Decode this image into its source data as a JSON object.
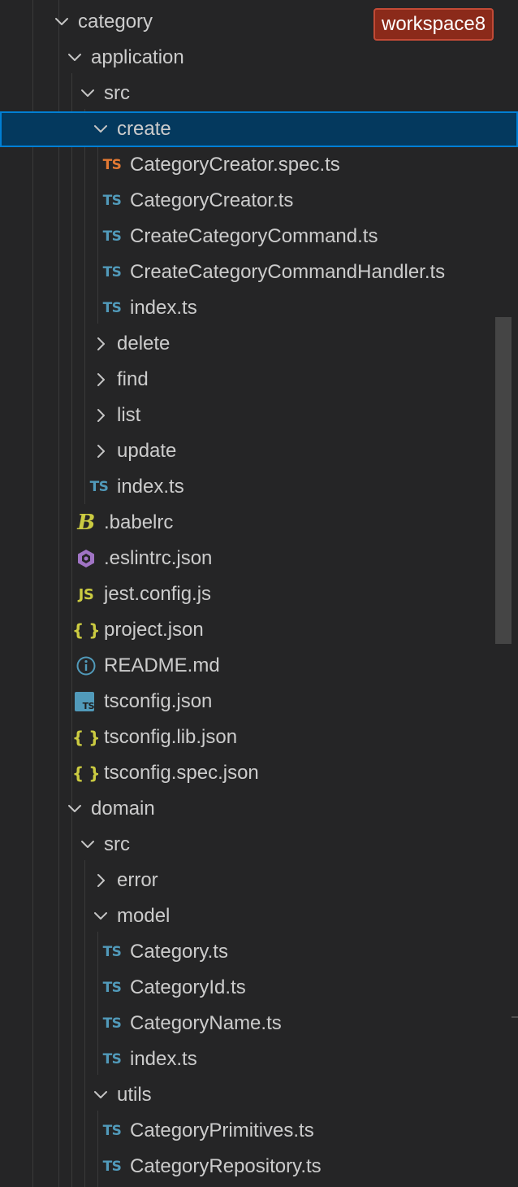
{
  "workspace_badge": "workspace8",
  "colors": {
    "ts_blue": "#519aba",
    "ts_spec_orange": "#e37933",
    "babel_yellow": "#cbcb41",
    "eslint_purple": "#a074c4",
    "json_yellow": "#cbcb41",
    "info_blue": "#519aba",
    "selection_bg": "#04395e",
    "selection_border": "#007fd4"
  },
  "tree": [
    {
      "label": "category",
      "depth": 0,
      "kind": "folder",
      "expanded": true
    },
    {
      "label": "application",
      "depth": 1,
      "kind": "folder",
      "expanded": true
    },
    {
      "label": "src",
      "depth": 2,
      "kind": "folder",
      "expanded": true
    },
    {
      "label": "create",
      "depth": 3,
      "kind": "folder",
      "expanded": true,
      "selected": true
    },
    {
      "label": "CategoryCreator.spec.ts",
      "depth": 4,
      "kind": "file",
      "icon": "ts-spec-icon",
      "glyph": "TS"
    },
    {
      "label": "CategoryCreator.ts",
      "depth": 4,
      "kind": "file",
      "icon": "typescript-icon",
      "glyph": "TS"
    },
    {
      "label": "CreateCategoryCommand.ts",
      "depth": 4,
      "kind": "file",
      "icon": "typescript-icon",
      "glyph": "TS"
    },
    {
      "label": "CreateCategoryCommandHandler.ts",
      "depth": 4,
      "kind": "file",
      "icon": "typescript-icon",
      "glyph": "TS"
    },
    {
      "label": "index.ts",
      "depth": 4,
      "kind": "file",
      "icon": "typescript-icon",
      "glyph": "TS"
    },
    {
      "label": "delete",
      "depth": 3,
      "kind": "folder",
      "expanded": false
    },
    {
      "label": "find",
      "depth": 3,
      "kind": "folder",
      "expanded": false
    },
    {
      "label": "list",
      "depth": 3,
      "kind": "folder",
      "expanded": false
    },
    {
      "label": "update",
      "depth": 3,
      "kind": "folder",
      "expanded": false
    },
    {
      "label": "index.ts",
      "depth": 3,
      "kind": "file",
      "icon": "typescript-icon",
      "glyph": "TS"
    },
    {
      "label": ".babelrc",
      "depth": 2,
      "kind": "file",
      "icon": "babel-icon",
      "glyph": "B"
    },
    {
      "label": ".eslintrc.json",
      "depth": 2,
      "kind": "file",
      "icon": "eslint-icon",
      "glyph": ""
    },
    {
      "label": "jest.config.js",
      "depth": 2,
      "kind": "file",
      "icon": "javascript-icon",
      "glyph": "JS"
    },
    {
      "label": "project.json",
      "depth": 2,
      "kind": "file",
      "icon": "json-icon",
      "glyph": "{ }"
    },
    {
      "label": "README.md",
      "depth": 2,
      "kind": "file",
      "icon": "info-icon",
      "glyph": ""
    },
    {
      "label": "tsconfig.json",
      "depth": 2,
      "kind": "file",
      "icon": "tsconfig-icon",
      "glyph": "TS"
    },
    {
      "label": "tsconfig.lib.json",
      "depth": 2,
      "kind": "file",
      "icon": "json-icon",
      "glyph": "{ }"
    },
    {
      "label": "tsconfig.spec.json",
      "depth": 2,
      "kind": "file",
      "icon": "json-icon",
      "glyph": "{ }"
    },
    {
      "label": "domain",
      "depth": 1,
      "kind": "folder",
      "expanded": true
    },
    {
      "label": "src",
      "depth": 2,
      "kind": "folder",
      "expanded": true
    },
    {
      "label": "error",
      "depth": 3,
      "kind": "folder",
      "expanded": false
    },
    {
      "label": "model",
      "depth": 3,
      "kind": "folder",
      "expanded": true
    },
    {
      "label": "Category.ts",
      "depth": 4,
      "kind": "file",
      "icon": "typescript-icon",
      "glyph": "TS"
    },
    {
      "label": "CategoryId.ts",
      "depth": 4,
      "kind": "file",
      "icon": "typescript-icon",
      "glyph": "TS"
    },
    {
      "label": "CategoryName.ts",
      "depth": 4,
      "kind": "file",
      "icon": "typescript-icon",
      "glyph": "TS"
    },
    {
      "label": "index.ts",
      "depth": 4,
      "kind": "file",
      "icon": "typescript-icon",
      "glyph": "TS"
    },
    {
      "label": "utils",
      "depth": 3,
      "kind": "folder",
      "expanded": true
    },
    {
      "label": "CategoryPrimitives.ts",
      "depth": 4,
      "kind": "file",
      "icon": "typescript-icon",
      "glyph": "TS"
    },
    {
      "label": "CategoryRepository.ts",
      "depth": 4,
      "kind": "file",
      "icon": "typescript-icon",
      "glyph": "TS"
    }
  ]
}
